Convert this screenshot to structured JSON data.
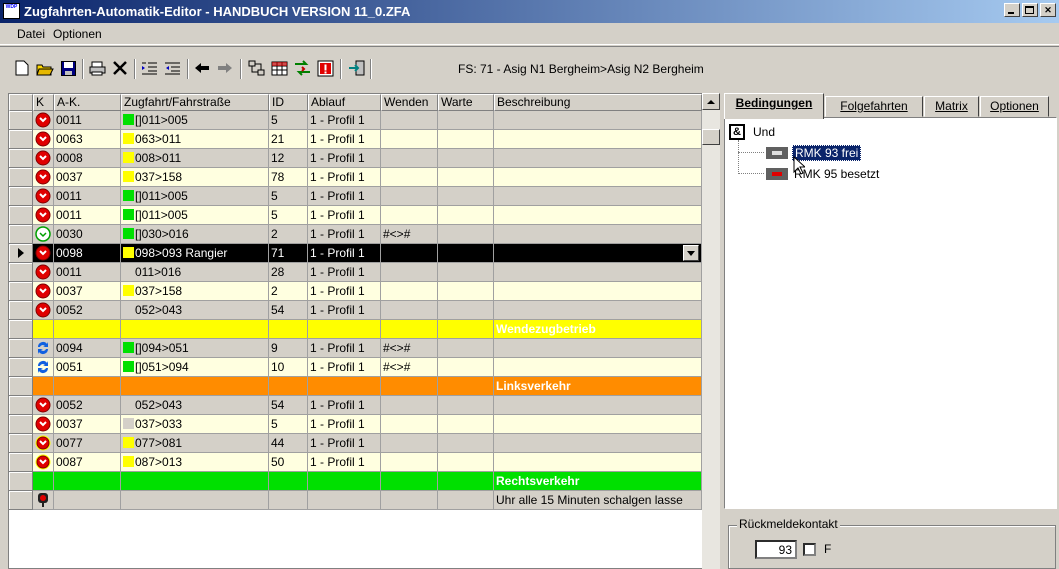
{
  "window": {
    "title": "Zugfahrten-Automatik-Editor - HANDBUCH VERSION 11_0.ZFA",
    "app_icon_text": "WDP"
  },
  "menu": {
    "items": [
      "Datei",
      "Optionen"
    ]
  },
  "toolbar": {
    "icons": [
      "new-icon",
      "open-icon",
      "save-icon",
      "print-icon",
      "delete-icon",
      "indent-icon",
      "outdent-icon",
      "arrow-left-icon",
      "arrow-right-icon",
      "route-icon",
      "table-icon",
      "swap-icon",
      "alert-icon",
      "exit-icon"
    ],
    "status_text": "FS: 71 - Asig N1 Bergheim>Asig N2 Bergheim"
  },
  "table": {
    "columns": [
      "K",
      "A-K.",
      "Zugfahrt/Fahrstraße",
      "ID",
      "Ablauf",
      "Wenden",
      "Warte",
      "Beschreibung"
    ],
    "rows": [
      {
        "k": "stop",
        "ak": "0011",
        "swatch": "#00e000",
        "fs": "[]011>005",
        "id": "5",
        "ablauf": "1 - Profil 1",
        "wenden": "",
        "warte": "",
        "beschr": "",
        "bg": "#d4d0c8"
      },
      {
        "k": "stop",
        "ak": "0063",
        "swatch": "#ffff00",
        "fs": "063>011",
        "id": "21",
        "ablauf": "1 - Profil 1",
        "wenden": "",
        "warte": "",
        "beschr": "",
        "bg": "#ffffe0"
      },
      {
        "k": "stop",
        "ak": "0008",
        "swatch": "#ffff00",
        "fs": "008>011",
        "id": "12",
        "ablauf": "1 - Profil 1",
        "wenden": "",
        "warte": "",
        "beschr": "",
        "bg": "#d4d0c8"
      },
      {
        "k": "stop",
        "ak": "0037",
        "swatch": "#ffff00",
        "fs": "037>158",
        "id": "78",
        "ablauf": "1 - Profil 1",
        "wenden": "",
        "warte": "",
        "beschr": "",
        "bg": "#ffffe0"
      },
      {
        "k": "stop",
        "ak": "0011",
        "swatch": "#00e000",
        "fs": "[]011>005",
        "id": "5",
        "ablauf": "1 - Profil 1",
        "wenden": "",
        "warte": "",
        "beschr": "",
        "bg": "#d4d0c8"
      },
      {
        "k": "stop",
        "ak": "0011",
        "swatch": "#00e000",
        "fs": "[]011>005",
        "id": "5",
        "ablauf": "1 - Profil 1",
        "wenden": "",
        "warte": "",
        "beschr": "",
        "bg": "#ffffe0"
      },
      {
        "k": "go",
        "ak": "0030",
        "swatch": "#00e000",
        "fs": "[]030>016",
        "id": "2",
        "ablauf": "1 - Profil 1",
        "wenden": "#<>#",
        "warte": "",
        "beschr": "",
        "bg": "#d4d0c8"
      },
      {
        "k": "stop",
        "ak": "0098",
        "swatch": "#ffff00",
        "fs": "098>093 Rangier",
        "id": "71",
        "ablauf": "1 - Profil 1",
        "wenden": "",
        "warte": "",
        "beschr": "",
        "bg": "#000000",
        "selected": true
      },
      {
        "k": "stop",
        "ak": "0011",
        "swatch": "#d4d0c8",
        "fs": "011>016",
        "id": "28",
        "ablauf": "1 - Profil 1",
        "wenden": "",
        "warte": "",
        "beschr": "",
        "bg": "#d4d0c8"
      },
      {
        "k": "stop",
        "ak": "0037",
        "swatch": "#ffff00",
        "fs": "037>158",
        "id": "2",
        "ablauf": "1 - Profil 1",
        "wenden": "",
        "warte": "",
        "beschr": "",
        "bg": "#ffffe0"
      },
      {
        "k": "stop",
        "ak": "0052",
        "swatch": "#d4d0c8",
        "fs": "052>043",
        "id": "54",
        "ablauf": "1 - Profil 1",
        "wenden": "",
        "warte": "",
        "beschr": "",
        "bg": "#d4d0c8"
      },
      {
        "k": "",
        "ak": "",
        "swatch": "",
        "fs": "",
        "id": "",
        "ablauf": "",
        "wenden": "",
        "warte": "",
        "beschr": "Wendezugbetrieb",
        "bg": "#ffff00",
        "section": true
      },
      {
        "k": "swap",
        "ak": "0094",
        "swatch": "#00e000",
        "fs": "[]094>051",
        "id": "9",
        "ablauf": "1 - Profil 1",
        "wenden": "#<>#",
        "warte": "",
        "beschr": "",
        "bg": "#d4d0c8"
      },
      {
        "k": "swap",
        "ak": "0051",
        "swatch": "#00e000",
        "fs": "[]051>094",
        "id": "10",
        "ablauf": "1 - Profil 1",
        "wenden": "#<>#",
        "warte": "",
        "beschr": "",
        "bg": "#ffffe0"
      },
      {
        "k": "",
        "ak": "",
        "swatch": "",
        "fs": "",
        "id": "",
        "ablauf": "",
        "wenden": "",
        "warte": "",
        "beschr": "Linksverkehr",
        "bg": "#ff8c00",
        "section": true
      },
      {
        "k": "stop",
        "ak": "0052",
        "swatch": "#d4d0c8",
        "fs": "052>043",
        "id": "54",
        "ablauf": "1 - Profil 1",
        "wenden": "",
        "warte": "",
        "beschr": "",
        "bg": "#d4d0c8"
      },
      {
        "k": "stop",
        "ak": "0037",
        "swatch": "#d4d0c8",
        "fs": "037>033",
        "id": "5",
        "ablauf": "1 - Profil 1",
        "wenden": "",
        "warte": "",
        "beschr": "",
        "bg": "#ffffe0"
      },
      {
        "k": "stopy",
        "ak": "0077",
        "swatch": "#ffff00",
        "fs": "077>081",
        "id": "44",
        "ablauf": "1 - Profil 1",
        "wenden": "",
        "warte": "",
        "beschr": "",
        "bg": "#d4d0c8"
      },
      {
        "k": "stopy",
        "ak": "0087",
        "swatch": "#ffff00",
        "fs": "087>013",
        "id": "50",
        "ablauf": "1 - Profil 1",
        "wenden": "",
        "warte": "",
        "beschr": "",
        "bg": "#ffffe0"
      },
      {
        "k": "",
        "ak": "",
        "swatch": "",
        "fs": "",
        "id": "",
        "ablauf": "",
        "wenden": "",
        "warte": "",
        "beschr": "Rechtsverkehr",
        "bg": "#00e000",
        "section": true
      },
      {
        "k": "signal",
        "ak": "",
        "swatch": "",
        "fs": "",
        "id": "",
        "ablauf": "",
        "wenden": "",
        "warte": "",
        "beschr": "Uhr alle 15 Minuten schalgen lasse",
        "bg": "#d4d0c8"
      }
    ]
  },
  "tabs": [
    "Bedingungen",
    "Folgefahrten",
    "Matrix",
    "Optionen"
  ],
  "tree": {
    "root_label": "Und",
    "root_icon_text": "&",
    "children": [
      {
        "label": "RMK 93 frei",
        "selected": true
      },
      {
        "label": "RMK 95 besetzt",
        "selected": false
      }
    ]
  },
  "rueckmelde": {
    "label": "Rückmeldekontakt",
    "value": "93",
    "checkbox_label": "F"
  },
  "colors": {
    "selection": "#0a246a",
    "title_start": "#0a246a",
    "title_end": "#a6caf0"
  }
}
